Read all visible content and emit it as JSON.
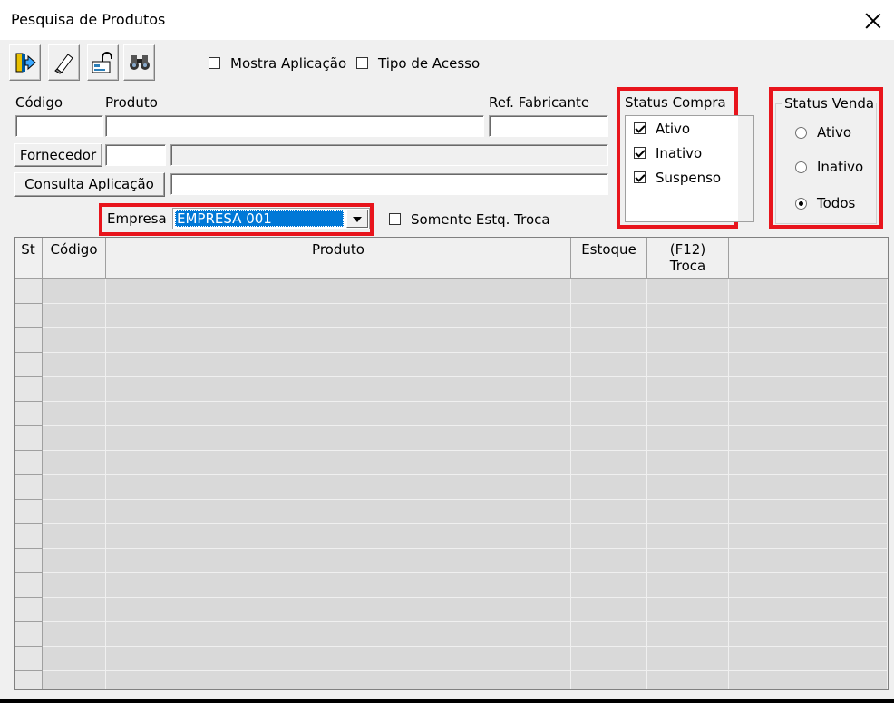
{
  "window": {
    "title": "Pesquisa de Produtos"
  },
  "toolbar": {
    "buttons": [
      {
        "icon": "exit-door-icon"
      },
      {
        "icon": "eraser-icon"
      },
      {
        "icon": "unlock-card-icon"
      },
      {
        "icon": "binoculars-icon"
      }
    ],
    "mostra_aplicacao": {
      "label": "Mostra Aplicação",
      "checked": false
    },
    "tipo_acesso": {
      "label": "Tipo de Acesso",
      "checked": false
    }
  },
  "filters": {
    "codigo_label": "Código",
    "produto_label": "Produto",
    "ref_fabricante_label": "Ref. Fabricante",
    "fornecedor_button": "Fornecedor",
    "consulta_aplicacao_button": "Consulta Aplicação",
    "empresa_label": "Empresa",
    "empresa_value": "EMPRESA 001",
    "somente_estq_troca": {
      "label": "Somente Estq. Troca",
      "checked": false
    }
  },
  "status_compra": {
    "title": "Status Compra",
    "items": [
      {
        "label": "Ativo",
        "checked": true
      },
      {
        "label": "Inativo",
        "checked": true
      },
      {
        "label": "Suspenso",
        "checked": true
      }
    ]
  },
  "status_venda": {
    "title": "Status Venda",
    "options": [
      {
        "label": "Ativo",
        "selected": false
      },
      {
        "label": "Inativo",
        "selected": false
      },
      {
        "label": "Todos",
        "selected": true
      }
    ]
  },
  "grid": {
    "columns": [
      "St",
      "Código",
      "Produto",
      "Estoque",
      "(F12)\nTroca",
      ""
    ],
    "empty_rows": 17
  },
  "colors": {
    "highlight": "#e8141c",
    "selection": "#0078d7"
  }
}
